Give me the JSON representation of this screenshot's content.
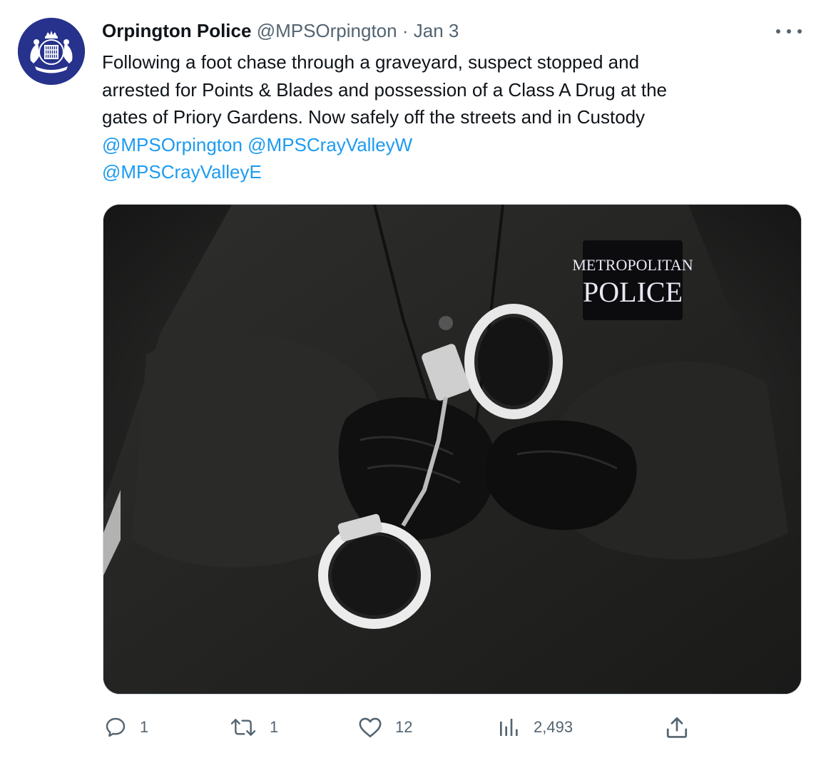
{
  "tweet": {
    "author_name": "Orpington Police",
    "handle": "@MPSOrpington",
    "separator": "·",
    "date": "Jan 3",
    "text_lines": [
      "Following a foot chase through a graveyard, suspect stopped and",
      "arrested for Points & Blades and possession of a Class A Drug at the",
      "gates of Priory Gardens. Now safely off the streets and in Custody"
    ],
    "mentions": [
      "@MPSOrpington",
      "@MPSCrayValleyW",
      "@MPSCrayValleyE"
    ],
    "image": {
      "badge_line1": "METROPOLITAN",
      "badge_line2": "POLICE"
    }
  },
  "actions": {
    "reply_count": "1",
    "retweet_count": "1",
    "like_count": "12",
    "views_count": "2,493"
  },
  "icons": {
    "more": "more-options-icon",
    "reply": "reply-icon",
    "retweet": "retweet-icon",
    "like": "heart-icon",
    "views": "analytics-icon",
    "share": "share-icon"
  },
  "colors": {
    "link": "#1d9bf0",
    "secondary_text": "#536471",
    "avatar_bg": "#26328b"
  }
}
